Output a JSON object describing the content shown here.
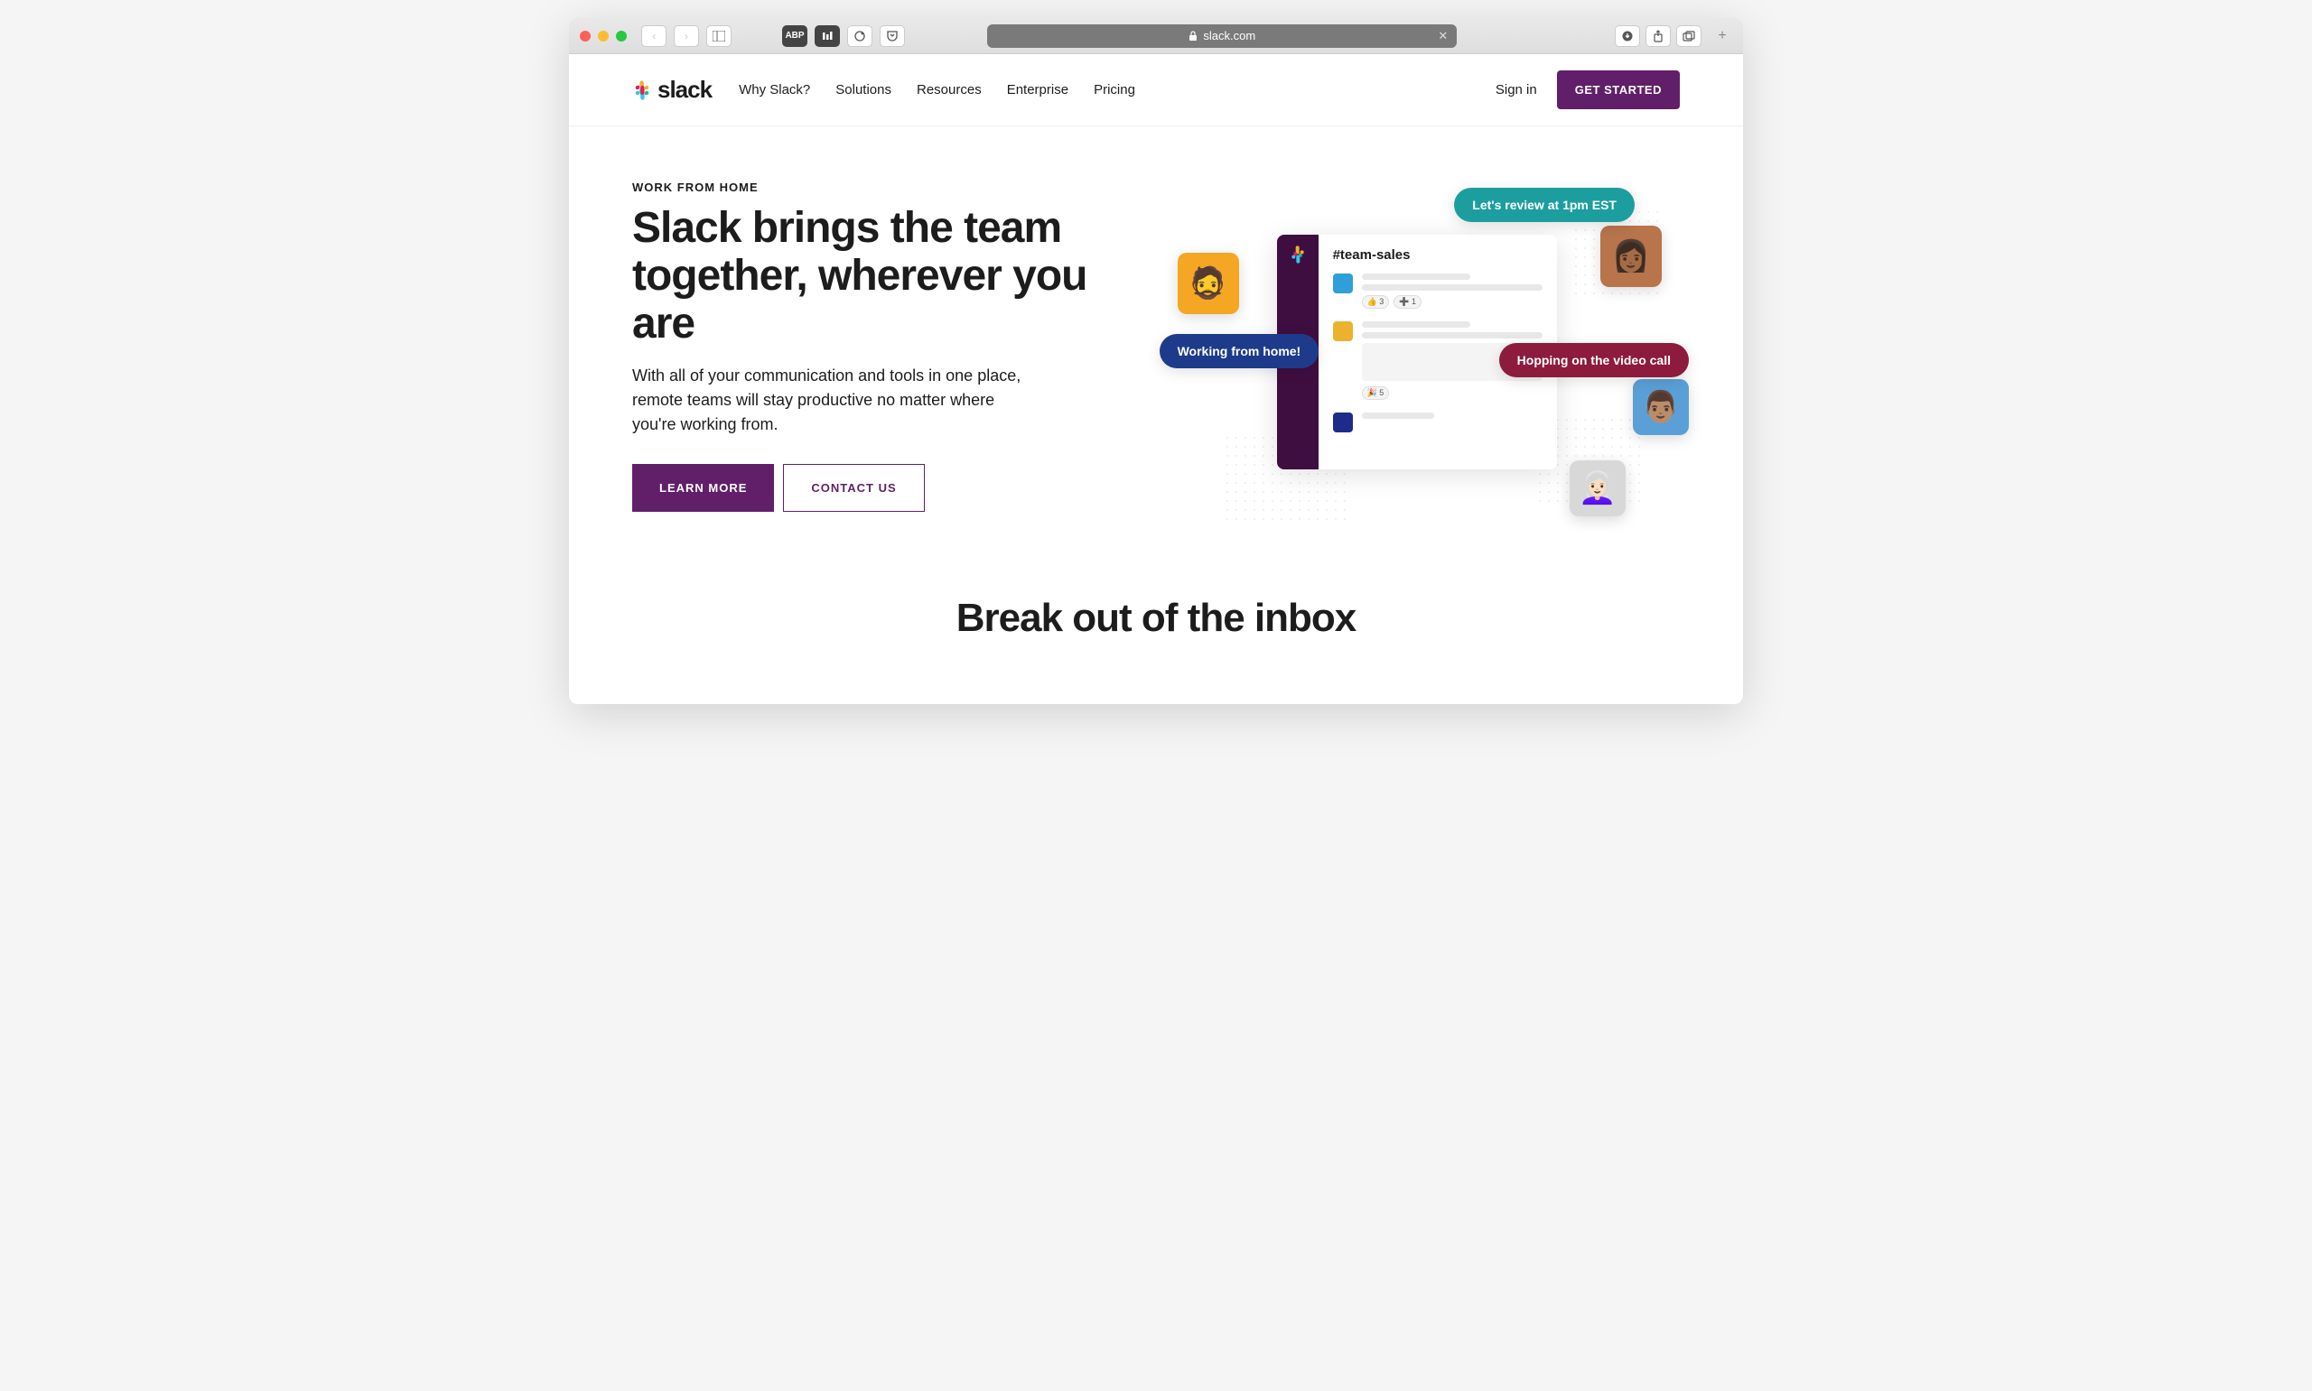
{
  "browser": {
    "url_display": "slack.com",
    "lock_icon": "lock-icon"
  },
  "header": {
    "logo_text": "slack",
    "nav": [
      "Why Slack?",
      "Solutions",
      "Resources",
      "Enterprise",
      "Pricing"
    ],
    "signin": "Sign in",
    "cta": "GET STARTED"
  },
  "hero": {
    "eyebrow": "WORK FROM HOME",
    "headline": "Slack brings the team together, wherever you are",
    "subcopy": "With all of your communication and tools in one place, remote teams will stay productive no matter where you're working from.",
    "primary_btn": "LEARN MORE",
    "secondary_btn": "CONTACT US"
  },
  "illustration": {
    "channel": "#team-sales",
    "bubbles": {
      "teal": "Let's review at 1pm EST",
      "navy": "Working from home!",
      "maroon": "Hopping on the video call"
    },
    "reactions": {
      "r1": "👍 3",
      "r2": "➕ 1",
      "r3": "🎉 5"
    }
  },
  "section2": {
    "headline": "Break out of the inbox"
  }
}
